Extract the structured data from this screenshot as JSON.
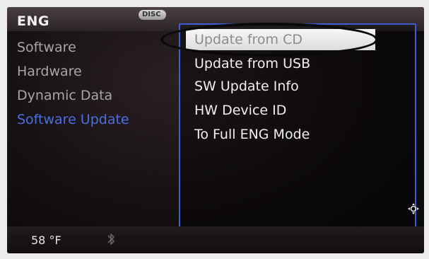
{
  "header": {
    "title": "ENG",
    "disc_badge": "DISC"
  },
  "left_menu": {
    "items": [
      {
        "label": "Software",
        "active": false
      },
      {
        "label": "Hardware",
        "active": false
      },
      {
        "label": "Dynamic Data",
        "active": false
      },
      {
        "label": "Software Update",
        "active": true
      }
    ]
  },
  "submenu": {
    "items": [
      {
        "label": "Update from CD",
        "selected": true
      },
      {
        "label": "Update from USB",
        "selected": false
      },
      {
        "label": "SW Update Info",
        "selected": false
      },
      {
        "label": "HW Device ID",
        "selected": false
      },
      {
        "label": "To Full ENG Mode",
        "selected": false
      }
    ]
  },
  "footer": {
    "temperature": "58 °F",
    "icons": [
      "bluetooth-icon",
      "joystick-icon"
    ]
  },
  "colors": {
    "accent_blue": "#3c5fd2",
    "active_text": "#4b6fe0",
    "annotation": "#0a0a0a"
  }
}
